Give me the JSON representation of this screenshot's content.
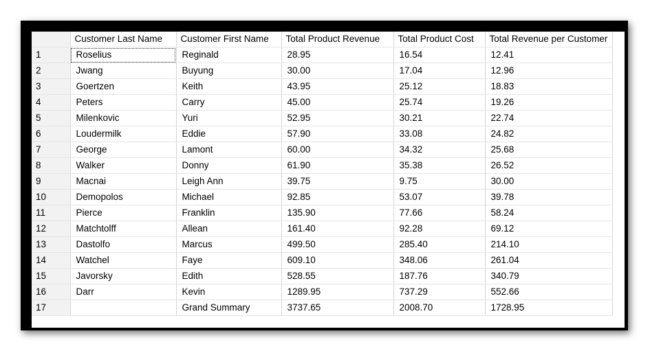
{
  "grid": {
    "columns": [
      "",
      "Customer Last Name",
      "Customer First Name",
      "Total Product Revenue",
      "Total Product Cost",
      "Total Revenue per Customer"
    ],
    "rows": [
      [
        "1",
        "Roselius",
        "Reginald",
        "28.95",
        "16.54",
        "12.41"
      ],
      [
        "2",
        "Jwang",
        "Buyung",
        "30.00",
        "17.04",
        "12.96"
      ],
      [
        "3",
        "Goertzen",
        "Keith",
        "43.95",
        "25.12",
        "18.83"
      ],
      [
        "4",
        "Peters",
        "Carry",
        "45.00",
        "25.74",
        "19.26"
      ],
      [
        "5",
        "Milenkovic",
        "Yuri",
        "52.95",
        "30.21",
        "22.74"
      ],
      [
        "6",
        "Loudermilk",
        "Eddie",
        "57.90",
        "33.08",
        "24.82"
      ],
      [
        "7",
        "George",
        "Lamont",
        "60.00",
        "34.32",
        "25.68"
      ],
      [
        "8",
        "Walker",
        "Donny",
        "61.90",
        "35.38",
        "26.52"
      ],
      [
        "9",
        "Macnai",
        "Leigh Ann",
        "39.75",
        "9.75",
        "30.00"
      ],
      [
        "10",
        "Demopolos",
        "Michael",
        "92.85",
        "53.07",
        "39.78"
      ],
      [
        "11",
        "Pierce",
        "Franklin",
        "135.90",
        "77.66",
        "58.24"
      ],
      [
        "12",
        "Matchtolff",
        "Allean",
        "161.40",
        "92.28",
        "69.12"
      ],
      [
        "13",
        "Dastolfo",
        "Marcus",
        "499.50",
        "285.40",
        "214.10"
      ],
      [
        "14",
        "Watchel",
        "Faye",
        "609.10",
        "348.06",
        "261.04"
      ],
      [
        "15",
        "Javorsky",
        "Edith",
        "528.55",
        "187.76",
        "340.79"
      ],
      [
        "16",
        "Darr",
        "Kevin",
        "1289.95",
        "737.29",
        "552.66"
      ],
      [
        "17",
        "",
        "Grand Summary",
        "3737.65",
        "2008.70",
        "1728.95"
      ]
    ]
  }
}
